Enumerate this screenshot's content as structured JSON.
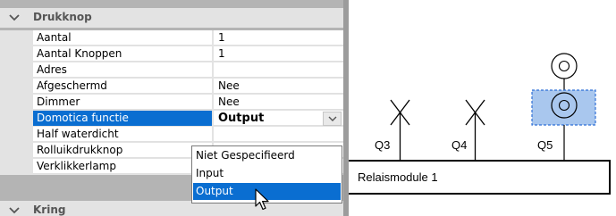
{
  "property_grid": {
    "categories": [
      {
        "label": "Drukknop",
        "expanded": true
      },
      {
        "label": "Kring",
        "expanded": true
      }
    ],
    "properties": [
      {
        "name": "Aantal",
        "value": "1"
      },
      {
        "name": "Aantal Knoppen",
        "value": "1"
      },
      {
        "name": "Adres",
        "value": ""
      },
      {
        "name": "Afgeschermd",
        "value": "Nee"
      },
      {
        "name": "Dimmer",
        "value": "Nee"
      },
      {
        "name": "Domotica functie",
        "value": "Output",
        "selected": true
      },
      {
        "name": "Half waterdicht",
        "value": ""
      },
      {
        "name": "Rolluikdrukknop",
        "value": ""
      },
      {
        "name": "Verklikkerlamp",
        "value": ""
      }
    ],
    "dropdown": {
      "options": [
        "Niet Gespecifieerd",
        "Input",
        "Output"
      ],
      "highlighted": "Output"
    }
  },
  "diagram": {
    "switches": [
      {
        "label": "Q3",
        "symbol": "cross"
      },
      {
        "label": "Q4",
        "symbol": "cross"
      },
      {
        "label": "Q5",
        "symbol": "pushbutton-lamp",
        "selected": true
      }
    ],
    "module_label": "Relaismodule 1"
  },
  "colors": {
    "selection": "#0a6ed1",
    "grid_background": "#e3e3e3",
    "selected_symbol_fill": "#a9c7ee",
    "selected_symbol_border": "#2f6fd6"
  }
}
